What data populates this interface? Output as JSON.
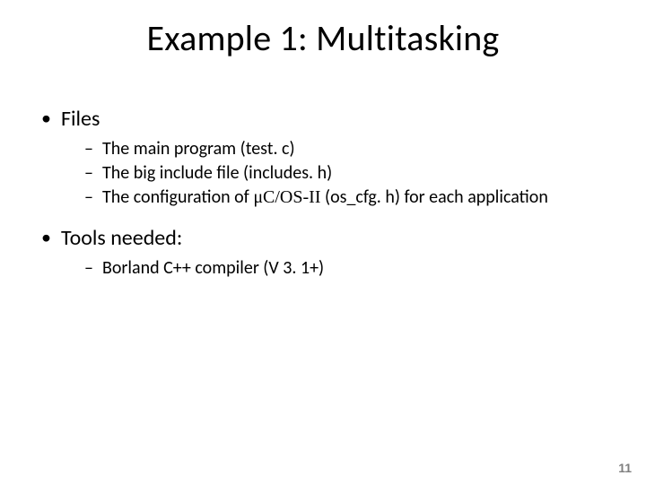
{
  "title": "Example 1: Multitasking",
  "sections": [
    {
      "heading": "Files",
      "items": [
        {
          "text": "The main program (test. c)"
        },
        {
          "text": "The big include file (includes. h)"
        },
        {
          "prefix": "The configuration of ",
          "serif": "μC/OS-II",
          "suffix": " (os_cfg. h) for each application"
        }
      ]
    },
    {
      "heading": "Tools needed:",
      "items": [
        {
          "text": "Borland C++ compiler (V 3. 1+)"
        }
      ]
    }
  ],
  "page_number": "11"
}
